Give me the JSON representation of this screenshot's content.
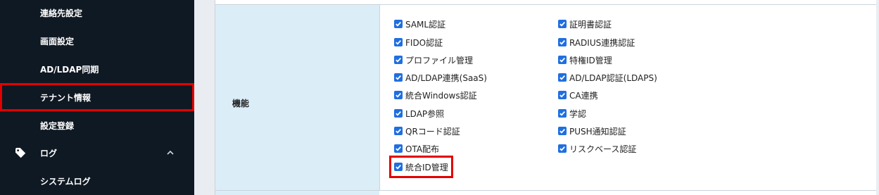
{
  "sidebar": {
    "items": [
      {
        "label": "連絡先設定"
      },
      {
        "label": "画面設定"
      },
      {
        "label": "AD/LDAP同期"
      },
      {
        "label": "テナント情報"
      },
      {
        "label": "設定登録"
      }
    ],
    "section": {
      "label": "ログ",
      "icon": "tag-icon",
      "chevron": "chevron-up-icon"
    },
    "sub_items": [
      {
        "label": "システムログ"
      }
    ],
    "highlight_color": "#e30000"
  },
  "main": {
    "row_label": "機能",
    "features_left": [
      {
        "label": "SAML認証",
        "checked": true
      },
      {
        "label": "FIDO認証",
        "checked": true
      },
      {
        "label": "プロファイル管理",
        "checked": true
      },
      {
        "label": "AD/LDAP連携(SaaS)",
        "checked": true
      },
      {
        "label": "統合Windows認証",
        "checked": true
      },
      {
        "label": "LDAP参照",
        "checked": true
      },
      {
        "label": "QRコード認証",
        "checked": true
      },
      {
        "label": "OTA配布",
        "checked": true
      },
      {
        "label": "統合ID管理",
        "checked": true
      }
    ],
    "features_right": [
      {
        "label": "証明書認証",
        "checked": true
      },
      {
        "label": "RADIUS連携認証",
        "checked": true
      },
      {
        "label": "特権ID管理",
        "checked": true
      },
      {
        "label": "AD/LDAP認証(LDAPS)",
        "checked": true
      },
      {
        "label": "CA連携",
        "checked": true
      },
      {
        "label": "学認",
        "checked": true
      },
      {
        "label": "PUSH通知認証",
        "checked": true
      },
      {
        "label": "リスクベース認証",
        "checked": true
      }
    ],
    "checkbox_color": "#1f6fe0",
    "label_cell_color": "#dbeef8"
  }
}
